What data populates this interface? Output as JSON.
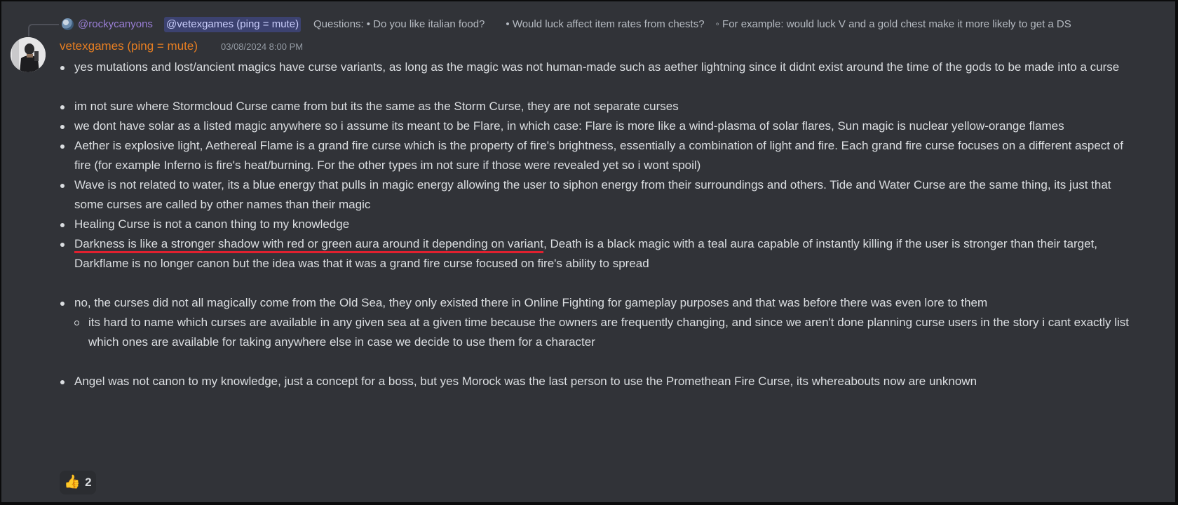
{
  "reply": {
    "username": "@rockycanyons",
    "mention": "@vetexgames (ping = mute)",
    "questions_label": "Questions:",
    "snippet_items": [
      "• Do you like italian food?",
      "• Would luck affect item rates from chests?",
      "◦ For example: would luck V and a gold chest make it more likely to get a DS"
    ]
  },
  "message": {
    "author": "vetexgames (ping = mute)",
    "timestamp": "03/08/2024 8:00 PM",
    "author_color": "#e67e22",
    "bullets": [
      "yes mutations and lost/ancient magics have curse variants, as long as the magic was not human-made such as aether lightning since it didnt exist around the time of the gods to be made into a curse",
      "im not sure where Stormcloud Curse came from but its the same as the Storm Curse, they are not separate curses",
      "we dont have solar as a listed magic anywhere so i assume its meant to be Flare, in which case: Flare is more like a wind-plasma of solar flares, Sun magic is nuclear yellow-orange flames",
      "Aether is explosive light, Aethereal Flame is a grand fire curse which is the property of fire's brightness, essentially a combination of light and fire. Each grand fire curse focuses on a different aspect of fire (for example Inferno is fire's heat/burning. For the other types im not sure if those were revealed yet so i wont spoil)",
      "Wave is not related to water, its a blue energy that pulls in magic energy allowing the user to siphon energy from their surroundings and others. Tide and Water Curse are the same thing, its just that some curses are called by other names than their magic",
      "Healing Curse is not a canon thing to my knowledge"
    ],
    "darkness_underlined": "Darkness is like a stronger shadow with red or green aura around it depending on variant",
    "darkness_rest": ", Death is a black magic with a teal aura capable of instantly killing if the user is stronger than their target, Darkflame is no longer canon but the idea was that it was a grand fire curse focused on fire's ability to spread",
    "old_sea": "no, the curses did not all magically come from the Old Sea, they only existed there in Online Fighting for gameplay purposes and that was before there was even lore to them",
    "old_sea_sub": "its hard to name which curses are available in any given sea at a given time because the owners are frequently changing, and since we aren't done planning curse users in the story i cant exactly list which ones are available for taking anywhere else in case we decide to use them for a character",
    "angel": "Angel was not canon to my knowledge, just a concept for a boss, but yes Morock was the last person to use the Promethean Fire Curse, its whereabouts now are unknown"
  },
  "reaction": {
    "emoji": "👍",
    "emoji_name": "thumbs-up",
    "count": "2"
  },
  "colors": {
    "background": "#313338",
    "text": "#dbdee1",
    "mention_bg": "#3c4270",
    "underline": "#e0202f"
  }
}
